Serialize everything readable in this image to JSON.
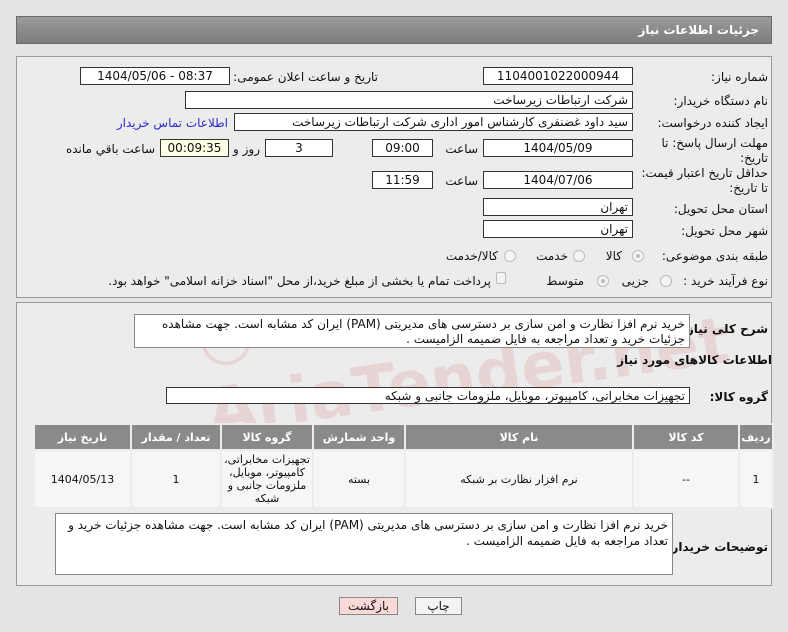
{
  "header": {
    "title": "جزئیات اطلاعات نیاز"
  },
  "watermark": "AriaTender.net",
  "form": {
    "need_number": {
      "label": "شماره نیاز:",
      "value": "1104001022000944"
    },
    "announce": {
      "label": "تاریخ و ساعت اعلان عمومی:",
      "value": "1404/05/06 - 08:37"
    },
    "buyer_org": {
      "label": "نام دستگاه خریدار:",
      "value": "شرکت ارتباطات زیرساخت"
    },
    "creator": {
      "label": "ایجاد کننده درخواست:",
      "value": "سید داود غضنفری کارشناس امور اداری شرکت ارتباطات زیرساخت",
      "contact_link": "اطلاعات تماس خریدار"
    },
    "deadline": {
      "label": "مهلت ارسال پاسخ: تا تاریخ:",
      "date": "1404/05/09",
      "time_label": "ساعت",
      "time": "09:00",
      "days": "3",
      "days_label": "روز و",
      "remaining": "00:09:35",
      "remaining_label": "ساعت باقي مانده"
    },
    "validity": {
      "label": "حداقل تاریخ اعتبار قیمت: تا تاریخ:",
      "date": "1404/07/06",
      "time_label": "ساعت",
      "time": "11:59"
    },
    "province": {
      "label": "استان محل تحویل:",
      "value": "تهران"
    },
    "city": {
      "label": "شهر محل تحویل:",
      "value": "تهران"
    },
    "category": {
      "label": "طبقه بندی موضوعی:",
      "options": [
        "کالا",
        "خدمت",
        "کالا/خدمت"
      ],
      "selected": "کالا"
    },
    "purchase_type": {
      "label": "نوع فرآیند خرید :",
      "options": [
        "جزیی",
        "متوسط"
      ],
      "selected": "متوسط",
      "checkbox_label": "پرداخت تمام یا بخشی از مبلغ خرید،از محل \"اسناد خزانه اسلامی\" خواهد بود.",
      "checkbox_checked": false
    }
  },
  "details": {
    "description_label": "شرح کلی نیاز:",
    "description": "خرید نرم افزا نظارت و امن سازی بر دسترسی های مدیریتی (PAM) ایران کد مشابه است. جهت مشاهده جزئیات خرید و تعداد مراجعه به فایل ضمیمه الزامیست .",
    "items_title": "اطلاعات کالاهای مورد نیاز",
    "group_label": "گروه کالا:",
    "group_value": "تجهیزات مخابراتی، کامپیوتر، موبایل، ملزومات جانبی و شبکه",
    "table": {
      "headers": [
        "ردیف",
        "کد کالا",
        "نام کالا",
        "واحد شمارش",
        "گروه کالا",
        "تعداد / مقدار",
        "تاریخ نیاز"
      ],
      "rows": [
        [
          "1",
          "--",
          "نرم افزار نظارت بر شبکه",
          "بسته",
          "تجهیزات مخابراتی، کامپیوتر، موبایل، ملزومات جانبی و شبکه",
          "1",
          "1404/05/13"
        ]
      ]
    },
    "notes_label": "توضیحات خریدار:",
    "notes": "خرید نرم افزا نظارت و امن سازی بر دسترسی های مدیریتی (PAM) ایران کد مشابه است. جهت مشاهده جزئیات خرید و تعداد مراجعه به فایل ضمیمه الزامیست ."
  },
  "buttons": {
    "print": "چاپ",
    "back": "بازگشت"
  }
}
